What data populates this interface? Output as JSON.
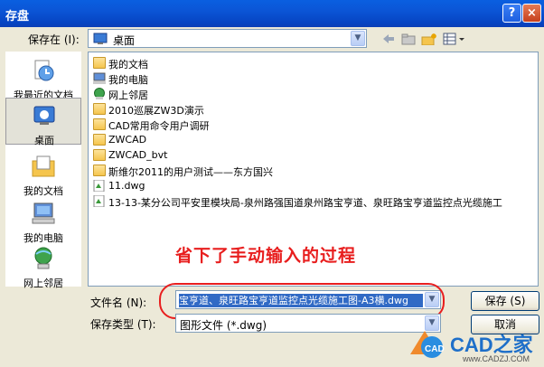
{
  "window": {
    "title": "存盘"
  },
  "save_in": {
    "label": "保存在 (I):",
    "value": "桌面"
  },
  "places": [
    {
      "label": "我最近的文档"
    },
    {
      "label": "桌面"
    },
    {
      "label": "我的文档"
    },
    {
      "label": "我的电脑"
    },
    {
      "label": "网上邻居"
    }
  ],
  "files": [
    {
      "name": "我的文档",
      "icon": "my-documents-icon"
    },
    {
      "name": "我的电脑",
      "icon": "my-computer-icon"
    },
    {
      "name": "网上邻居",
      "icon": "network-icon"
    },
    {
      "name": "2010巡展ZW3D演示",
      "icon": "folder-icon"
    },
    {
      "name": "CAD常用命令用户调研",
      "icon": "folder-icon"
    },
    {
      "name": "ZWCAD",
      "icon": "folder-icon"
    },
    {
      "name": "ZWCAD_bvt",
      "icon": "folder-icon"
    },
    {
      "name": "斯维尔2011的用户测试——东方国兴",
      "icon": "folder-icon"
    },
    {
      "name": "11.dwg",
      "icon": "dwg-file-icon"
    },
    {
      "name": "13-13-某分公司平安里模块局-泉州路强国道泉州路宝亨道、泉旺路宝亨道监控点光缆施工",
      "icon": "dwg-file-icon"
    }
  ],
  "annotation": "省下了手动输入的过程",
  "filename": {
    "label": "文件名 (N):",
    "value": "宝亨道、泉旺路宝亨道监控点光缆施工图-A3横.dwg"
  },
  "filetype": {
    "label": "保存类型 (T):",
    "value": "图形文件 (*.dwg)"
  },
  "buttons": {
    "save": "保存 (S)",
    "cancel": "取消"
  },
  "watermark": {
    "brand": "CAD之家",
    "url": "www.CADZJ.COM",
    "logo_text": "CAD"
  }
}
